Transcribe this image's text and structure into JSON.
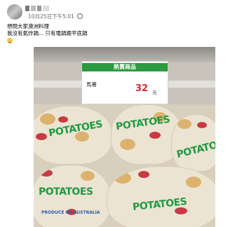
{
  "post": {
    "timestamp": "10月25日下午5:01",
    "caption_lines": [
      "想問大家澳洲料理",
      "我沒有氣炸鍋... 只有電鍋跟平底鍋"
    ]
  },
  "photo": {
    "shelf_tag": {
      "header": "熱賣商品",
      "product": "馬薯",
      "price": "32",
      "unit": "元"
    },
    "bag_words": [
      "POTATOES",
      "POTATOES",
      "POTATOES",
      "POTATOES",
      "POTATOES"
    ],
    "bag_subtext": "PRODUCE OF AUSTRALIA"
  }
}
